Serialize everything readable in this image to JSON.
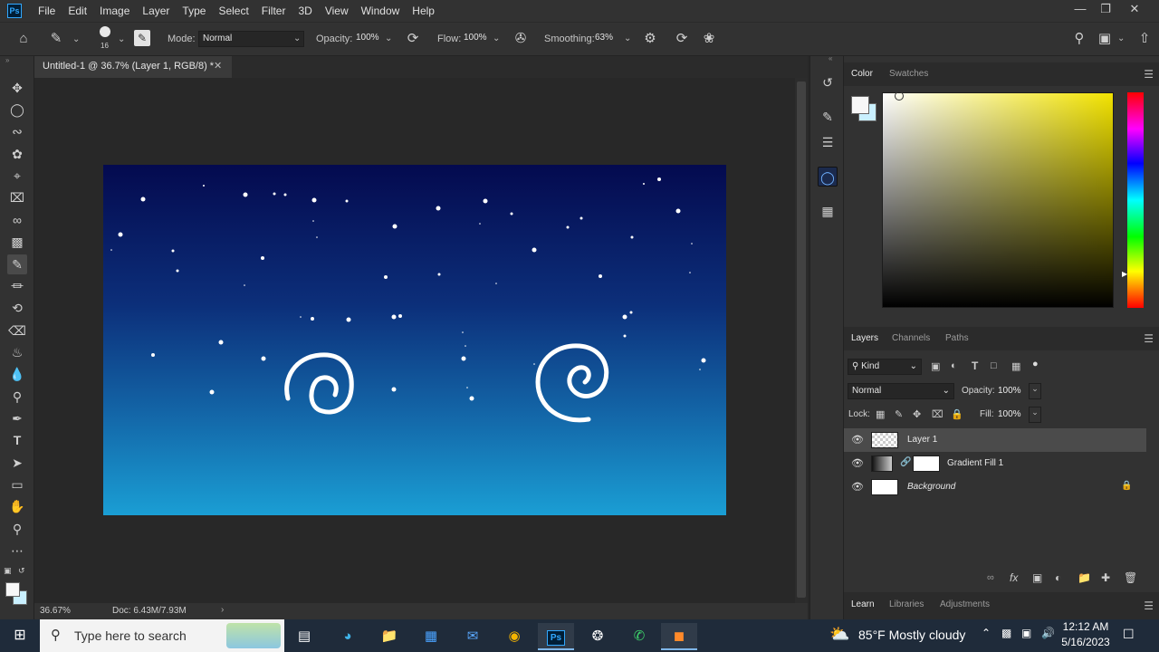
{
  "app": {
    "logo": "Ps",
    "menu": [
      "File",
      "Edit",
      "Image",
      "Layer",
      "Type",
      "Select",
      "Filter",
      "3D",
      "View",
      "Window",
      "Help"
    ]
  },
  "options": {
    "brush_size": "16",
    "mode_label": "Mode:",
    "mode_value": "Normal",
    "opacity_label": "Opacity:",
    "opacity_value": "100%",
    "flow_label": "Flow:",
    "flow_value": "100%",
    "smoothing_label": "Smoothing:",
    "smoothing_value": "63%"
  },
  "document": {
    "tab_title": "Untitled-1 @ 36.7% (Layer 1, RGB/8) *",
    "zoom": "36.67%",
    "doc_info": "Doc: 6.43M/7.93M"
  },
  "color_panel": {
    "tabs": [
      "Color",
      "Swatches"
    ],
    "foreground": "#f7f7f7",
    "background": "#c9f0ff"
  },
  "layers_panel": {
    "tabs": [
      "Layers",
      "Channels",
      "Paths"
    ],
    "filter_kind": "Kind",
    "blend_mode": "Normal",
    "opacity_label": "Opacity:",
    "opacity_value": "100%",
    "lock_label": "Lock:",
    "fill_label": "Fill:",
    "fill_value": "100%",
    "layers": [
      {
        "name": "Layer 1",
        "selected": true
      },
      {
        "name": "Gradient Fill 1",
        "selected": false
      },
      {
        "name": "Background",
        "selected": false
      }
    ]
  },
  "bottom_tabs": [
    "Learn",
    "Libraries",
    "Adjustments"
  ],
  "taskbar": {
    "search_placeholder": "Type here to search",
    "weather": "85°F  Mostly cloudy",
    "time": "12:12 AM",
    "date": "5/16/2023"
  }
}
